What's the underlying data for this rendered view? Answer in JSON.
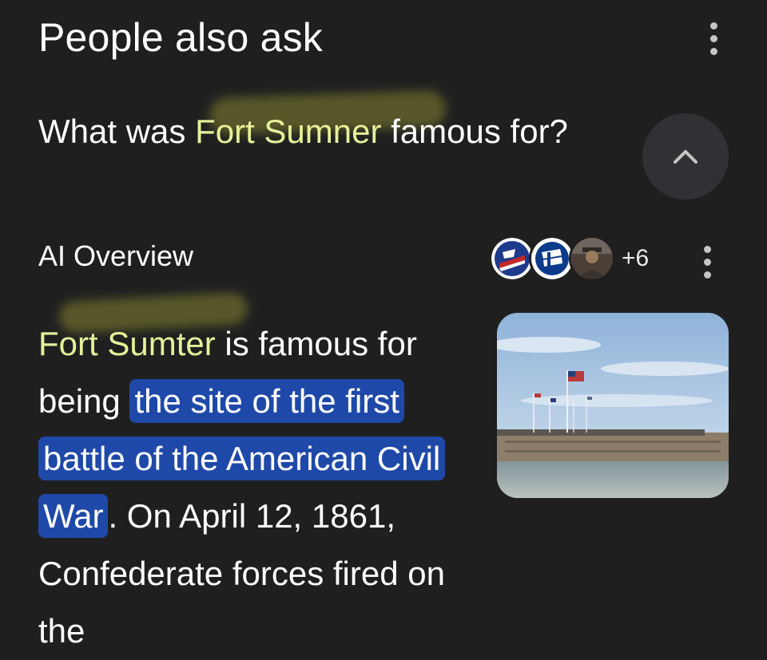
{
  "section": {
    "title": "People also ask"
  },
  "question": {
    "prefix": "What was ",
    "highlight": "Fort Sumner",
    "suffix": " famous for?"
  },
  "ai_overview": {
    "label": "AI Overview",
    "sources": [
      {
        "icon": "flag-shield-logo-icon",
        "colors": [
          "#1e3a8a",
          "#c62828",
          "#ffffff"
        ]
      },
      {
        "icon": "park-service-logo-icon",
        "colors": [
          "#0d3b8c",
          "#ffffff"
        ]
      },
      {
        "icon": "person-avatar-icon",
        "colors": [
          "#5b4a3a",
          "#8b6a4d"
        ]
      }
    ],
    "more_sources": "+6"
  },
  "answer": {
    "lead": "Fort Sumter",
    "text1": " is famous for being ",
    "highlight": "the site of the first battle of the American Civil War",
    "text2": ". On April 12, 1861, Confederate forces fired on the"
  },
  "thumbnail": {
    "icon": "fort-sumter-photo"
  },
  "colors": {
    "background": "#1f1f1f",
    "highlight_blue": "#1f49a8",
    "highlight_yellow_text": "#e6f09a"
  }
}
